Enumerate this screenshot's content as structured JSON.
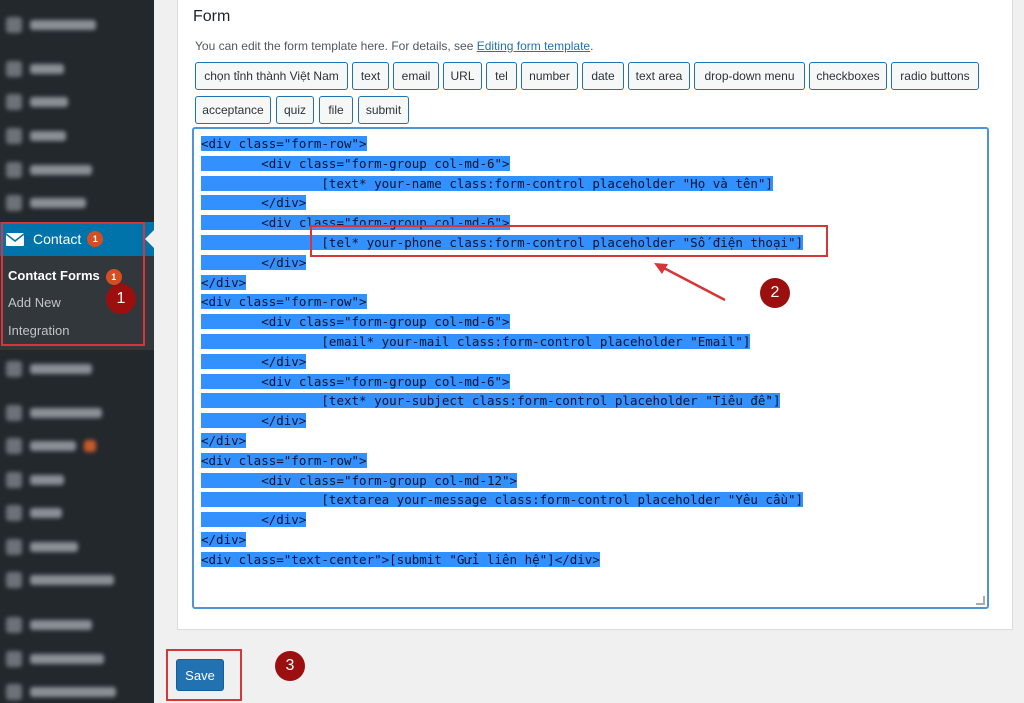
{
  "sidebar": {
    "contact_label": "Contact",
    "contact_badge": "1",
    "submenu": {
      "contact_forms": "Contact Forms",
      "contact_forms_badge": "1",
      "add_new": "Add New",
      "integration": "Integration"
    }
  },
  "form": {
    "title": "Form",
    "desc_text": "You can edit the form template here. For details, see ",
    "desc_link": "Editing form template",
    "desc_end": ".",
    "tags": [
      "chọn tỉnh thành Việt Nam",
      "text",
      "email",
      "URL",
      "tel",
      "number",
      "date",
      "text area",
      "drop-down menu",
      "checkboxes",
      "radio buttons",
      "acceptance",
      "quiz",
      "file",
      "submit"
    ],
    "code_lines": [
      "<div class=\"form-row\">",
      "        <div class=\"form-group col-md-6\">",
      "                [text* your-name class:form-control placeholder \"Họ và tên\"]",
      "        </div>",
      "        <div class=\"form-group col-md-6\">",
      "                [tel* your-phone class:form-control placeholder \"Số điện thoại\"]",
      "        </div>",
      "</div>",
      "<div class=\"form-row\">",
      "        <div class=\"form-group col-md-6\">",
      "                [email* your-mail class:form-control placeholder \"Email\"]",
      "        </div>",
      "        <div class=\"form-group col-md-6\">",
      "                [text* your-subject class:form-control placeholder \"Tiêu đề\"]",
      "        </div>",
      "</div>",
      "<div class=\"form-row\">",
      "        <div class=\"form-group col-md-12\">",
      "                [textarea your-message class:form-control placeholder \"Yêu cầu\"]",
      "        </div>",
      "</div>",
      "<div class=\"text-center\">[submit \"Gửi liên hệ\"]</div>"
    ]
  },
  "save_label": "Save",
  "annotations": [
    "1",
    "2",
    "3"
  ],
  "colors": {
    "sidebar_bg": "#23282d",
    "active_menu": "#0073aa",
    "selection": "#3390ff",
    "annotation_red": "#d63638",
    "circle": "#9b0f0f",
    "button_primary": "#2271b1"
  }
}
